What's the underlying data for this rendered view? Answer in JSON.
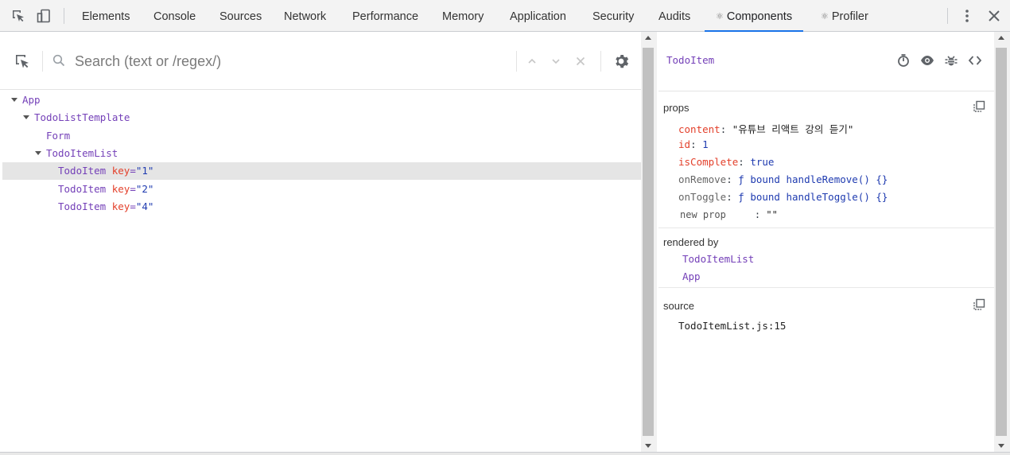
{
  "tabs": [
    {
      "label": "Elements"
    },
    {
      "label": "Console"
    },
    {
      "label": "Sources"
    },
    {
      "label": "Network"
    },
    {
      "label": "Performance"
    },
    {
      "label": "Memory"
    },
    {
      "label": "Application"
    },
    {
      "label": "Security"
    },
    {
      "label": "Audits"
    },
    {
      "label": "Components",
      "prefix": "⚛"
    },
    {
      "label": "Profiler",
      "prefix": "⚛"
    }
  ],
  "accent_color": "#1a73e8",
  "search": {
    "placeholder": "Search (text or /regex/)",
    "value": ""
  },
  "tree": [
    {
      "name": "App"
    },
    {
      "name": "TodoListTemplate"
    },
    {
      "name": "Form"
    },
    {
      "name": "TodoItemList"
    },
    {
      "name": "TodoItem",
      "key_attr": "key",
      "key_eq": "=",
      "key_val": "\"1\""
    },
    {
      "name": "TodoItem",
      "key_attr": "key",
      "key_eq": "=",
      "key_val": "\"2\""
    },
    {
      "name": "TodoItem",
      "key_attr": "key",
      "key_eq": "=",
      "key_val": "\"4\""
    }
  ],
  "selected_component": {
    "name": "TodoItem"
  },
  "props": {
    "title": "props",
    "items": [
      {
        "key": "content",
        "sep": ":",
        "value": "\"유튜브 리액트 강의 듣기\""
      },
      {
        "key": "id",
        "sep": ":",
        "value": "1"
      },
      {
        "key": "isComplete",
        "sep": ":",
        "value": "true"
      },
      {
        "key": "onRemove",
        "sep": ":",
        "value": "ƒ bound handleRemove() {}"
      },
      {
        "key": "onToggle",
        "sep": ":",
        "value": "ƒ bound handleToggle() {}"
      }
    ],
    "new_prop": {
      "key": "new prop",
      "sep": ":",
      "value": "\"\""
    }
  },
  "rendered_by": {
    "title": "rendered by",
    "items": [
      "TodoItemList",
      "App"
    ]
  },
  "source": {
    "title": "source",
    "value": "TodoItemList.js:15"
  },
  "icons": {
    "inspect_tool": "cursor-select-icon",
    "device_toolbar": "device-icon",
    "search": "search-icon",
    "settings": "gear-icon",
    "suspend": "stopwatch-icon",
    "inspect_dom": "eye-icon",
    "log": "bug-icon",
    "view_source": "code-icon",
    "copy": "copy-icon",
    "more": "kebab-icon",
    "close": "close-icon"
  }
}
